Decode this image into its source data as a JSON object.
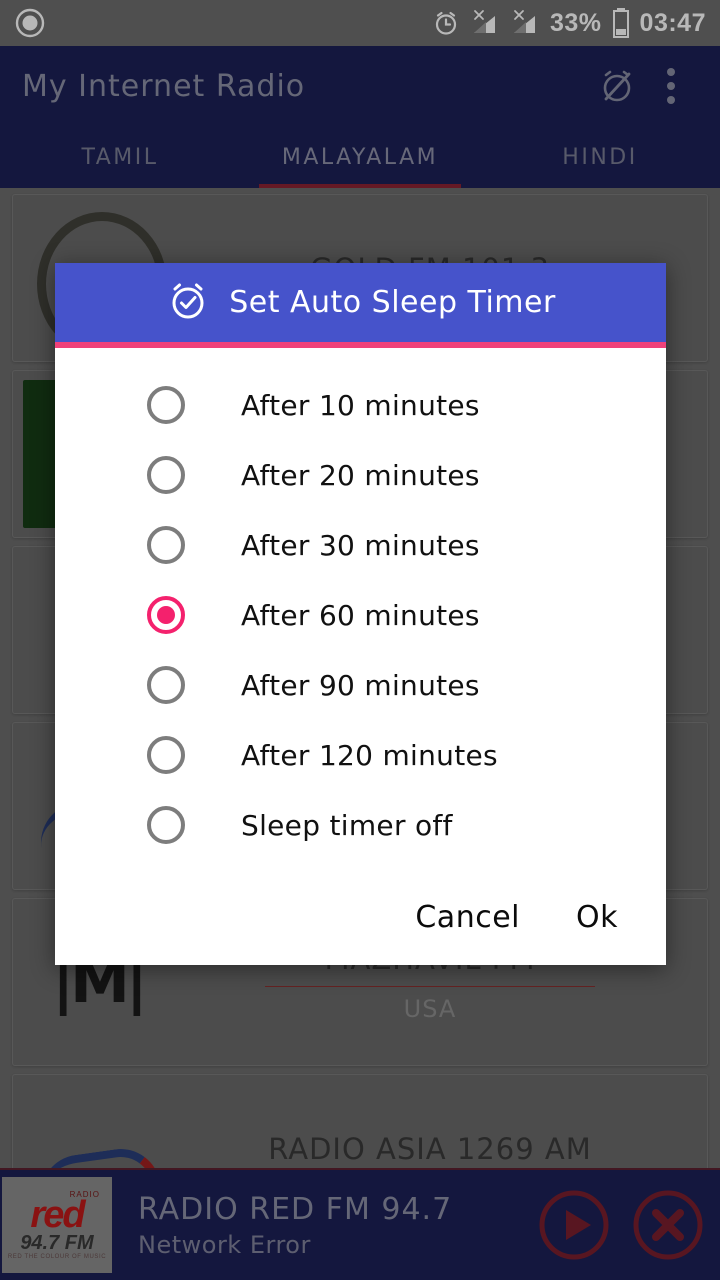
{
  "status_bar": {
    "notification_icon": "circle-record-icon",
    "alarm_icon": "alarm-clock-icon",
    "signal_1_icon": "signal-no-sim-icon",
    "signal_2_icon": "signal-no-sim-icon",
    "battery_percent": "33%",
    "battery_icon": "battery-icon",
    "time": "03:47"
  },
  "app_bar": {
    "title": "My Internet Radio",
    "alarm_off_icon": "alarm-off-icon",
    "overflow_icon": "more-vertical-icon"
  },
  "tabs": [
    {
      "label": "TAMIL",
      "active": false
    },
    {
      "label": "MALAYALAM",
      "active": true
    },
    {
      "label": "HINDI",
      "active": false
    }
  ],
  "stations": [
    {
      "name": "GOLD FM 101.3",
      "country": "",
      "art": "gold"
    },
    {
      "name": "",
      "country": "",
      "art": "green"
    },
    {
      "name": "",
      "country": "",
      "art": "nn"
    },
    {
      "name": "",
      "country": "",
      "art": "asia"
    },
    {
      "name": "MAZHAVIL FM",
      "country": "USA",
      "art": "mazhavil"
    },
    {
      "name": "RADIO ASIA 1269 AM",
      "country": "",
      "art": "radioasia"
    }
  ],
  "dialog": {
    "title": "Set Auto Sleep Timer",
    "title_icon": "alarm-check-icon",
    "header_color": "#4653cb",
    "accent_color": "#f0417a",
    "selected_index": 3,
    "options": [
      {
        "label": "After 10 minutes",
        "selected": false
      },
      {
        "label": "After 20 minutes",
        "selected": false
      },
      {
        "label": "After 30 minutes",
        "selected": false
      },
      {
        "label": "After 60 minutes",
        "selected": true
      },
      {
        "label": "After 90 minutes",
        "selected": false
      },
      {
        "label": "After 120 minutes",
        "selected": false
      },
      {
        "label": "Sleep timer off",
        "selected": false
      }
    ],
    "cancel_label": "Cancel",
    "ok_label": "Ok"
  },
  "player": {
    "station_title": "RADIO RED FM 94.7",
    "status": "Network Error",
    "play_icon": "play-circle-icon",
    "close_icon": "close-circle-icon",
    "logo": {
      "radio": "RADIO",
      "red": "red",
      "freq": "94.7 FM",
      "tagline": "RED THE COLOUR OF MUSIC"
    }
  }
}
